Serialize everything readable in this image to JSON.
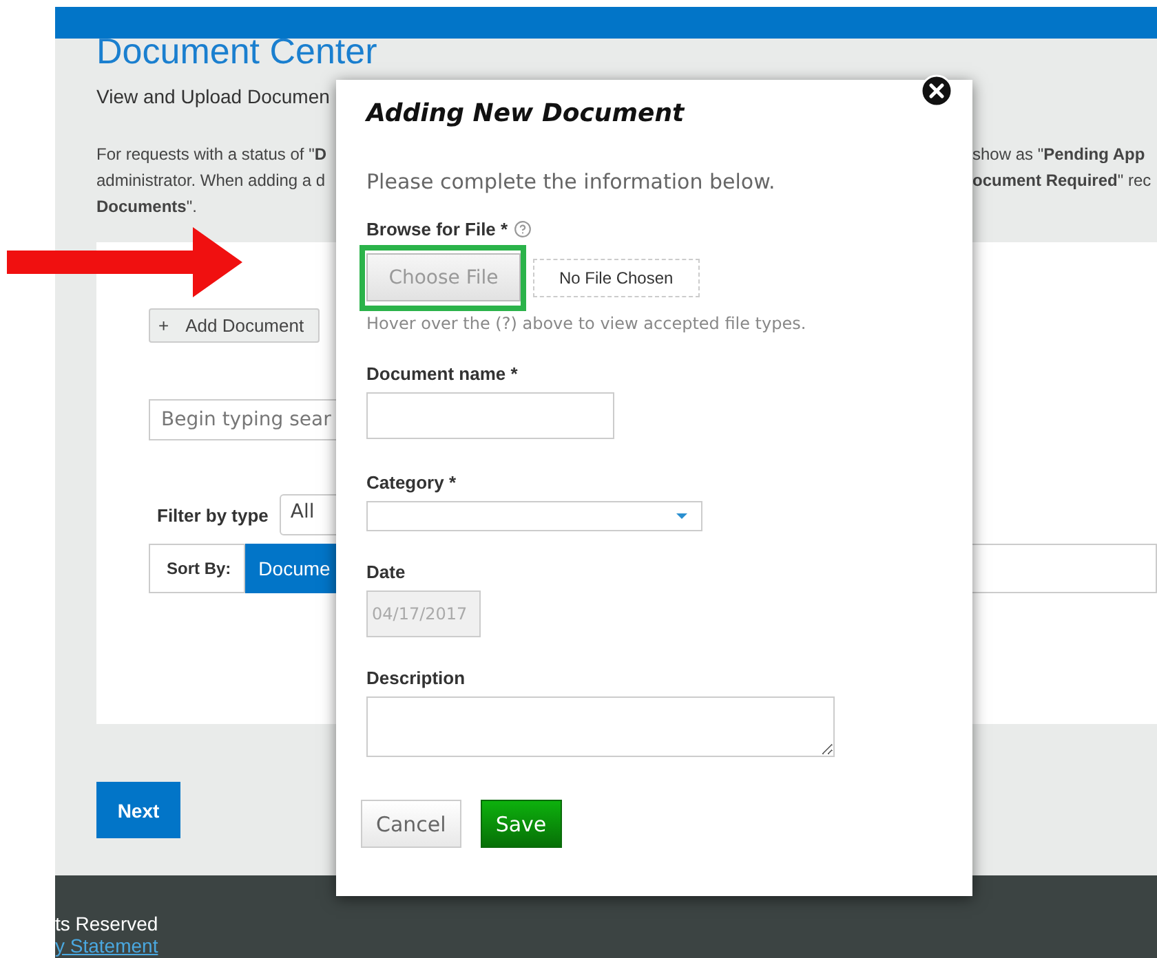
{
  "header": {
    "title": "Document Center",
    "subtitle": "View and Upload Documen"
  },
  "notice": {
    "left_lines": [
      "For requests with a status of \"**D**",
      "administrator. When adding a d",
      "**Documents**\"."
    ],
    "right_lines": [
      "show as \"**Pending App**",
      "**ocument Required**\" rec"
    ]
  },
  "add_button": {
    "icon": "+",
    "label": "Add Document"
  },
  "search": {
    "placeholder": "Begin typing sear"
  },
  "filter": {
    "label": "Filter by type",
    "value": "All"
  },
  "sort": {
    "label": "Sort By:",
    "options": [
      {
        "label": "Docume",
        "selected": true
      }
    ]
  },
  "next_button": "Next",
  "footer": {
    "rights": "ts Reserved",
    "link": "y Statement"
  },
  "dialog": {
    "title": "Adding New Document",
    "intro": "Please complete the information below.",
    "fields": [
      {
        "kind": "file",
        "label": "Browse for File *",
        "help": true,
        "button": "Choose File",
        "status": "No File Chosen",
        "hint": "Hover over the (?) above to view accepted file types.",
        "highlighted": true
      },
      {
        "kind": "text",
        "label": "Document name *"
      },
      {
        "kind": "select",
        "label": "Category *"
      },
      {
        "kind": "date",
        "label": "Date",
        "value": "04/17/2017",
        "disabled": true
      },
      {
        "kind": "textarea",
        "label": "Description"
      }
    ],
    "buttons": [
      {
        "kind": "cancel",
        "label": "Cancel"
      },
      {
        "kind": "save",
        "label": "Save"
      }
    ]
  }
}
